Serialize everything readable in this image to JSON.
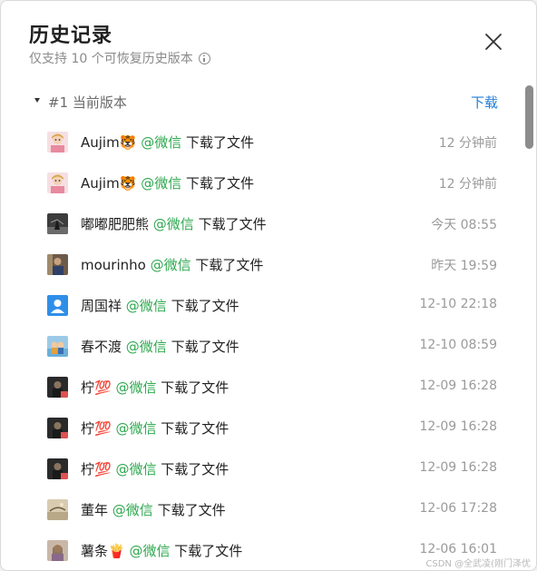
{
  "dialog": {
    "title": "历史记录",
    "subtitle": "仅支持 10 个可恢复历史版本",
    "icons": {
      "info": "info-icon",
      "close": "close-icon"
    }
  },
  "version": {
    "label": "#1 当前版本",
    "download_label": "下载",
    "accent_color": "#1f7ed6"
  },
  "source_color": "#2fa84f",
  "records": [
    {
      "name": "Aujim",
      "emoji": "🐯",
      "source": "@微信",
      "action": "下载了文件",
      "time": "12 分钟前"
    },
    {
      "name": "Aujim",
      "emoji": "🐯",
      "source": "@微信",
      "action": "下载了文件",
      "time": "12 分钟前"
    },
    {
      "name": "嘟嘟肥肥熊",
      "emoji": "",
      "source": "@微信",
      "action": "下载了文件",
      "time": "今天 08:55"
    },
    {
      "name": "mourinho",
      "emoji": "",
      "source": "@微信",
      "action": "下载了文件",
      "time": "昨天 19:59"
    },
    {
      "name": "周国祥",
      "emoji": "",
      "source": "@微信",
      "action": "下载了文件",
      "time": "12-10 22:18"
    },
    {
      "name": "春不渡",
      "emoji": "",
      "source": "@微信",
      "action": "下载了文件",
      "time": "12-10 08:59"
    },
    {
      "name": "柠",
      "emoji": "💯",
      "source": "@微信",
      "action": "下载了文件",
      "time": "12-09 16:28"
    },
    {
      "name": "柠",
      "emoji": "💯",
      "source": "@微信",
      "action": "下载了文件",
      "time": "12-09 16:28"
    },
    {
      "name": "柠",
      "emoji": "💯",
      "source": "@微信",
      "action": "下载了文件",
      "time": "12-09 16:28"
    },
    {
      "name": "董年",
      "emoji": "",
      "source": "@微信",
      "action": "下载了文件",
      "time": "12-06 17:28"
    },
    {
      "name": "薯条",
      "emoji": "🍟",
      "source": "@微信",
      "action": "下载了文件",
      "time": "12-06 16:01"
    }
  ],
  "watermark": "CSDN @全武凌(刚门泽优"
}
